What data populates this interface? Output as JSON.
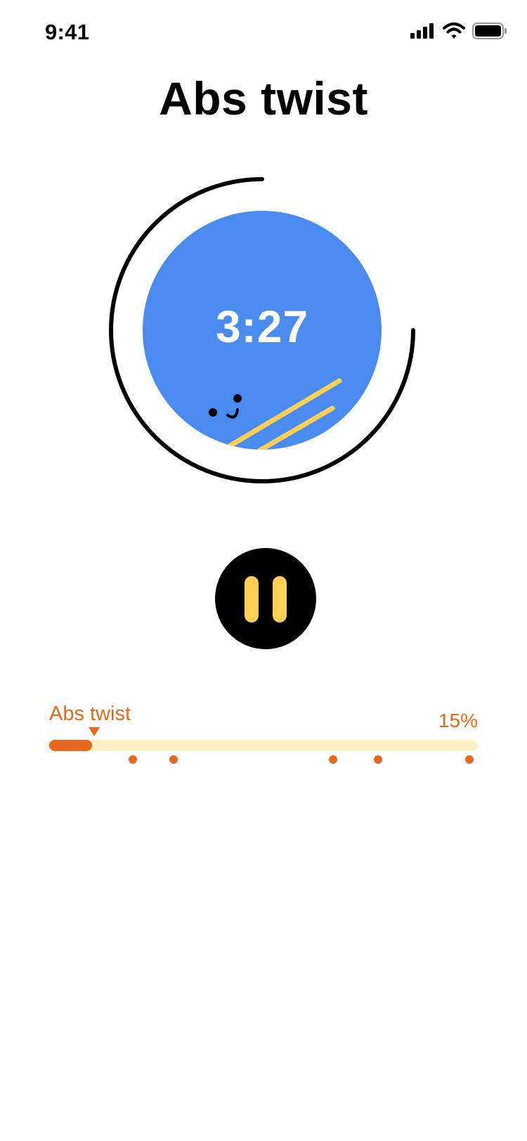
{
  "status_bar": {
    "time": "9:41"
  },
  "workout": {
    "title": "Abs twist",
    "timer": "3:27",
    "ring_progress": 0.75
  },
  "controls": {
    "pause_icon": "pause-icon"
  },
  "progress": {
    "current_exercise": "Abs twist",
    "percent_label": "15%",
    "percent_value": 0.1
  },
  "colors": {
    "timer_circle": "#4A8BF0",
    "accent_yellow": "#FFCF54",
    "accent_orange": "#E8691D",
    "track_light": "#FFF0C4"
  }
}
